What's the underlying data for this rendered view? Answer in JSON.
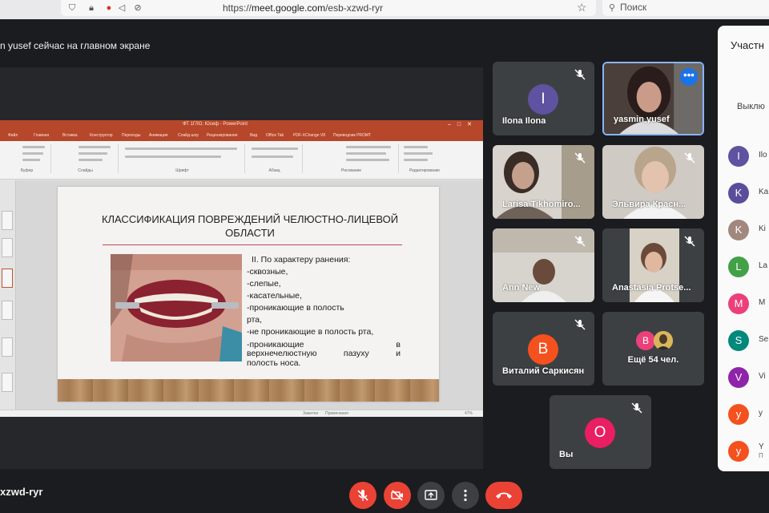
{
  "browser": {
    "url_prefix": "https://",
    "url_domain": "meet.google.com",
    "url_path": "/esb-xzwd-ryr",
    "search_placeholder": "Поиск"
  },
  "banner": {
    "presenting_text": "n yusef сейчас на главном экране"
  },
  "ppt": {
    "window_title": "ФТ 1ГЛО. Юсеф - PowerPoint",
    "tabs": [
      "Файл",
      "Главная",
      "Вставка",
      "Конструктор",
      "Переходы",
      "Анимация",
      "Слайд-шоу",
      "Рецензирование",
      "Вид",
      "Office Tab",
      "PDF-XChange V8",
      "Переводчик PROMT"
    ],
    "ribbon_groups": [
      "Буфер",
      "Слайды",
      "Шрифт",
      "Абзац",
      "Рисование",
      "Редактирование"
    ],
    "status_items": [
      "Заметки",
      "Примечания",
      "47%"
    ]
  },
  "slide": {
    "title": "КЛАССИФИКАЦИЯ ПОВРЕЖДЕНИЙ ЧЕЛЮСТНО-ЛИЦЕВОЙ ОБЛАСТИ",
    "heading": "II. По характеру ранения:",
    "items": [
      "-сквозные,",
      "-слепые,",
      "-касательные,",
      "-проникающие в полость",
      "рта,",
      "-не проникающие в полость рта,"
    ],
    "last_item_parts": [
      "-проникающие",
      "в"
    ],
    "last_item_line2_parts": [
      "верхнечелюстную",
      "пазуху",
      "и"
    ],
    "last_item_line3": "полость носа."
  },
  "tiles": [
    {
      "name": "Ilona Ilona",
      "initial": "I",
      "color": "#5f52a0"
    },
    {
      "name": "yasmin yusef"
    },
    {
      "name": "Larisa Tikhomiro..."
    },
    {
      "name": "Эльвира Красн..."
    },
    {
      "name": "Ann New"
    },
    {
      "name": "Anastasia Protse..."
    },
    {
      "name": "Виталий Саркисян",
      "initial": "В",
      "color": "#f4511e"
    },
    {
      "name": "Ещё 54 чел.",
      "initial": "B",
      "color": "#ec407a"
    },
    {
      "name": "Вы",
      "initial": "O",
      "color": "#e91e63"
    }
  ],
  "panel": {
    "title": "Участн",
    "subtitle": "Выклю",
    "participants": [
      {
        "initial": "I",
        "name": "Ilo",
        "color": "#5f52a0"
      },
      {
        "initial": "K",
        "name": "Ka",
        "color": "#5c4d9c"
      },
      {
        "initial": "K",
        "name": "Ki",
        "color": "#a1887f"
      },
      {
        "initial": "L",
        "name": "La",
        "color": "#43a047"
      },
      {
        "initial": "M",
        "name": "M",
        "color": "#ec407a"
      },
      {
        "initial": "S",
        "name": "Se",
        "color": "#00897b"
      },
      {
        "initial": "V",
        "name": "Vi",
        "color": "#8e24aa"
      },
      {
        "initial": "y",
        "name": "y",
        "color": "#f4511e"
      },
      {
        "initial": "y",
        "name": "Y",
        "color": "#f4511e",
        "sub": "П"
      }
    ]
  },
  "meeting": {
    "code": "xzwd-ryr"
  }
}
